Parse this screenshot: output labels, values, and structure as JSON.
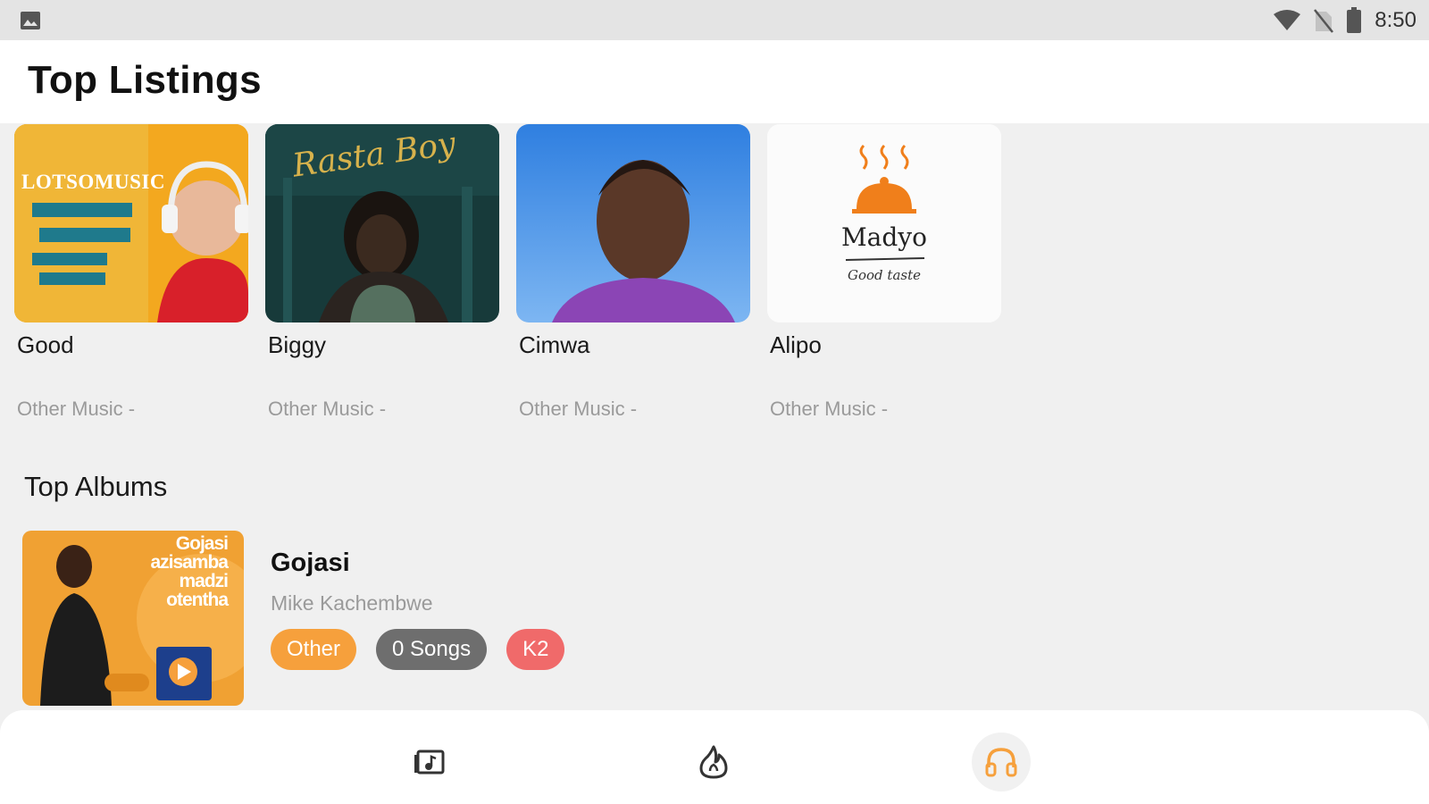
{
  "status_bar": {
    "time": "8:50",
    "icons": [
      "gallery-icon",
      "wifi-icon",
      "no-sim-icon",
      "battery-icon"
    ]
  },
  "header": {
    "title": "Top Listings"
  },
  "listings": [
    {
      "name": "Good",
      "genre": "Other Music -",
      "art_text": "LOTSOMUSIC"
    },
    {
      "name": "Biggy",
      "genre": "Other Music -",
      "art_text": "Rasta Boy"
    },
    {
      "name": "Cimwa",
      "genre": "Other Music -"
    },
    {
      "name": "Alipo",
      "genre": "Other Music -",
      "art_text": "Madyo",
      "art_subtext": "Good taste"
    }
  ],
  "top_albums": {
    "title": "Top Albums",
    "items": [
      {
        "title": "Gojasi",
        "artist": "Mike Kachembwe",
        "cover_text": [
          "Gojasi",
          "azisamba",
          "madzi",
          "otentha"
        ],
        "chips": [
          "Other",
          "0 Songs",
          "K2"
        ]
      }
    ]
  },
  "bottom_nav": {
    "items": [
      {
        "icon": "music-library-icon",
        "active": false
      },
      {
        "icon": "trending-fire-icon",
        "active": false
      },
      {
        "icon": "headphones-icon",
        "active": true
      }
    ]
  },
  "colors": {
    "accent": "#f6a03c",
    "chip_gray": "#6e6e6e",
    "chip_red": "#f06a6a",
    "background": "#f0f0f0"
  }
}
